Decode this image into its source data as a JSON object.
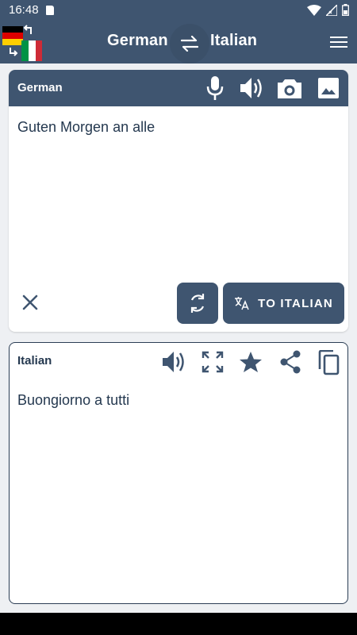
{
  "status": {
    "time": "16:48"
  },
  "header": {
    "from_lang": "German",
    "to_lang": "Italian"
  },
  "source": {
    "title": "German",
    "text": "Guten Morgen an alle",
    "translate_label": "TO ITALIAN"
  },
  "target": {
    "title": "Italian",
    "text": "Buongiorno a tutti"
  },
  "colors": {
    "primary": "#3f5570",
    "text": "#24384f",
    "background": "#eef0f3"
  }
}
